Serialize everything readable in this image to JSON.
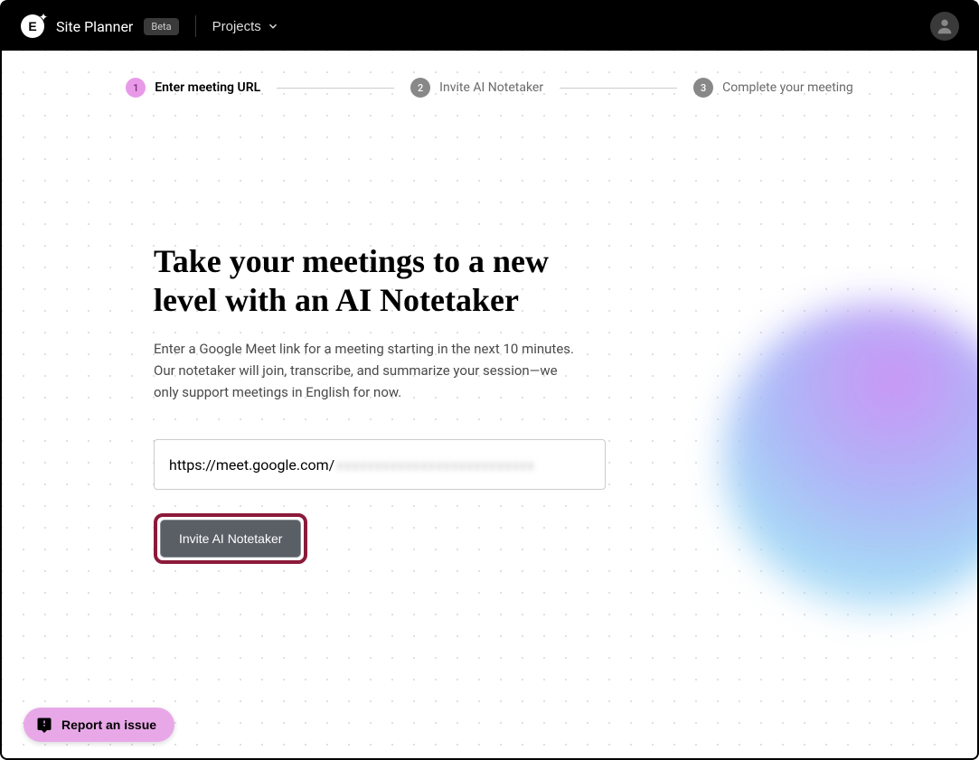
{
  "header": {
    "app_title": "Site Planner",
    "badge": "Beta",
    "projects_label": "Projects"
  },
  "stepper": {
    "steps": [
      {
        "num": "1",
        "label": "Enter meeting URL",
        "active": true
      },
      {
        "num": "2",
        "label": "Invite AI Notetaker",
        "active": false
      },
      {
        "num": "3",
        "label": "Complete your meeting",
        "active": false
      }
    ]
  },
  "content": {
    "heading": "Take your meetings to a new level with an AI Notetaker",
    "description": "Enter a Google Meet link for a meeting starting in the next 10 minutes. Our notetaker will join, transcribe, and summarize your session—we only support meetings in English for now.",
    "url_prefix": "https://meet.google.com/",
    "url_hidden": "xxxxxxxxxxxxxxxxxxxxxxxxxx",
    "invite_button": "Invite AI Notetaker"
  },
  "report": {
    "label": "Report an issue"
  }
}
